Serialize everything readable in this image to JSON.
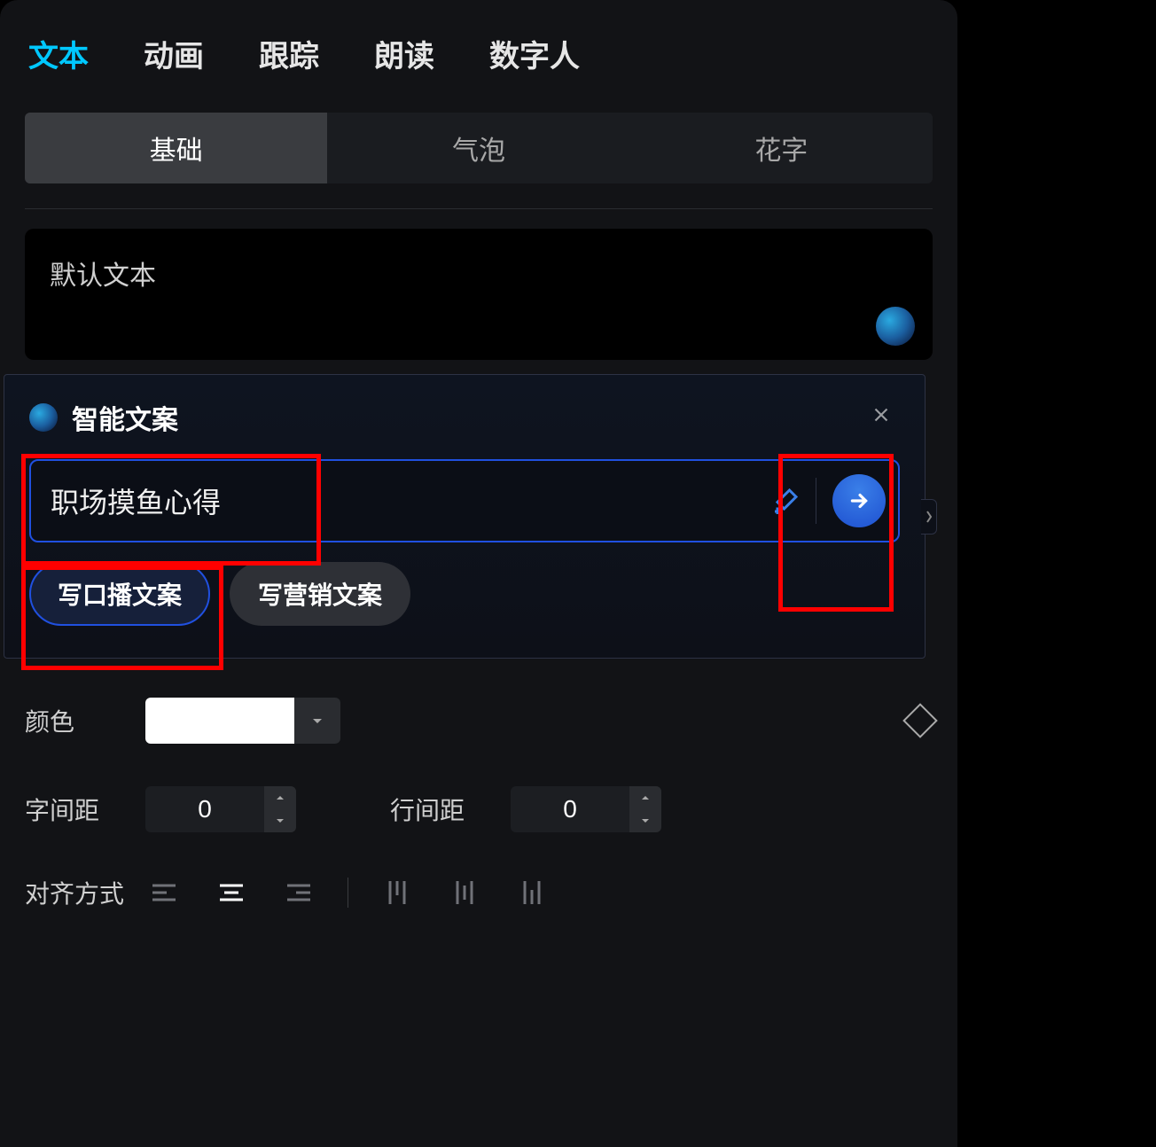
{
  "topTabs": {
    "t0": "文本",
    "t1": "动画",
    "t2": "跟踪",
    "t3": "朗读",
    "t4": "数字人"
  },
  "subTabs": {
    "s0": "基础",
    "s1": "气泡",
    "s2": "花字"
  },
  "textArea": {
    "text": "默认文本"
  },
  "smartCopy": {
    "title": "智能文案",
    "input": "职场摸鱼心得",
    "chips": {
      "c0": "写口播文案",
      "c1": "写营销文案"
    }
  },
  "props": {
    "color_label": "颜色",
    "char_spacing_label": "字间距",
    "char_spacing_value": "0",
    "line_spacing_label": "行间距",
    "line_spacing_value": "0",
    "align_label": "对齐方式"
  },
  "icons": {
    "close": "close",
    "arrow_right": "arrow-right",
    "magic": "magic-wand",
    "chevron_down": "chevron-down",
    "chevron_up": "chevron-up"
  },
  "colors": {
    "accent": "#00c8ff",
    "highlight": "#ff0000",
    "blue_border": "#2050e0"
  }
}
